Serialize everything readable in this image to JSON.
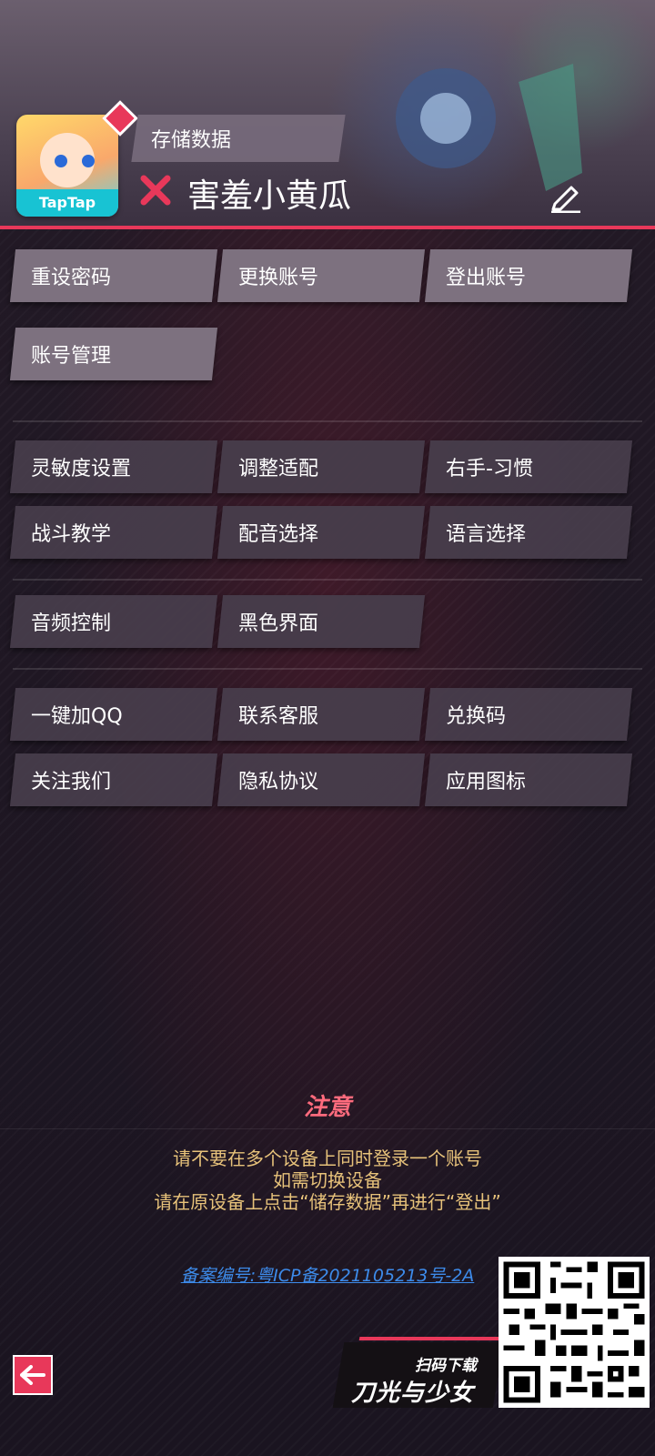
{
  "header": {
    "save_label": "存储数据",
    "nickname": "害羞小黄瓜",
    "avatar_tag": "TapTap",
    "accent": "#e8385a"
  },
  "account_buttons": [
    "重设密码",
    "更换账号",
    "登出账号",
    "账号管理"
  ],
  "settings_buttons": [
    "灵敏度设置",
    "调整适配",
    "右手-习惯",
    "战斗教学",
    "配音选择",
    "语言选择"
  ],
  "display_buttons": [
    "音频控制",
    "黑色界面"
  ],
  "social_buttons": [
    "一键加QQ",
    "联系客服",
    "兑换码",
    "关注我们",
    "隐私协议",
    "应用图标"
  ],
  "notice": {
    "title": "注意",
    "lines": [
      "请不要在多个设备上同时登录一个账号",
      "如需切换设备",
      "请在原设备上点击“储存数据”再进行“登出”"
    ]
  },
  "icp": "备案编号:粤ICP备2021105213号-2A",
  "promo": {
    "scan_label": "扫码下载",
    "game_title": "刀光与少女"
  },
  "icons": [
    "close-x-icon",
    "edit-pencil-icon",
    "back-arrow-icon",
    "qr-code-icon"
  ]
}
